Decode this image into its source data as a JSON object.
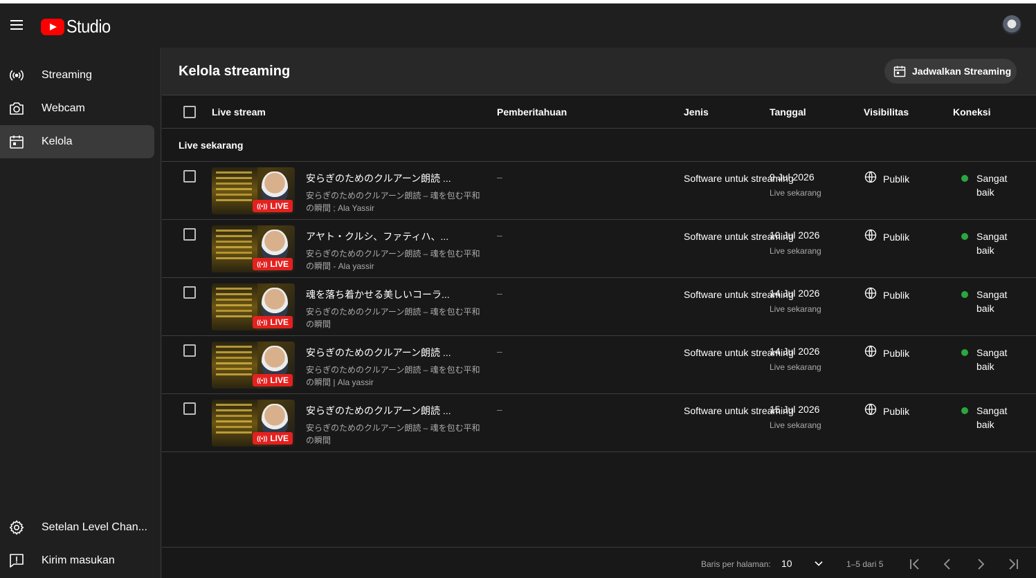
{
  "header": {
    "logo_text": "Studio",
    "menu_icon": "hamburger-menu-icon",
    "avatar_icon": "channel-avatar"
  },
  "sidebar": {
    "items": [
      {
        "label": "Streaming",
        "icon": "broadcast-icon"
      },
      {
        "label": "Webcam",
        "icon": "camera-icon"
      },
      {
        "label": "Kelola",
        "icon": "calendar-icon",
        "active": true
      }
    ],
    "bottom_items": [
      {
        "label": "Setelan Level Chan...",
        "icon": "gear-icon"
      },
      {
        "label": "Kirim masukan",
        "icon": "feedback-icon"
      }
    ]
  },
  "main": {
    "title": "Kelola streaming",
    "schedule_button": "Jadwalkan Streaming",
    "columns": [
      "Live stream",
      "Pemberitahuan",
      "Jenis",
      "Tanggal",
      "Visibilitas",
      "Koneksi"
    ],
    "section_label": "Live sekarang",
    "rows": [
      {
        "title": "安らぎのためのクルアーン朗読 ...",
        "desc": "安らぎのためのクルアーン朗読 – 魂を包む平和の瞬間 ; Ala Yassir",
        "notif": "–",
        "type": "Software untuk streaming",
        "date": "9 Jul 2026",
        "date_sub": "Live sekarang",
        "visibility": "Publik",
        "connection": "Sangat baik",
        "badge": "LIVE"
      },
      {
        "title": "アヤト・クルシ、ファティハ、...",
        "desc": "安らぎのためのクルアーン朗読 – 魂を包む平和の瞬間 - Ala yassir",
        "notif": "–",
        "type": "Software untuk streaming",
        "date": "10 Jul 2026",
        "date_sub": "Live sekarang",
        "visibility": "Publik",
        "connection": "Sangat baik",
        "badge": "LIVE"
      },
      {
        "title": "魂を落ち着かせる美しいコーラ...",
        "desc": "安らぎのためのクルアーン朗読 – 魂を包む平和の瞬間",
        "notif": "–",
        "type": "Software untuk streaming",
        "date": "14 Jul 2026",
        "date_sub": "Live sekarang",
        "visibility": "Publik",
        "connection": "Sangat baik",
        "badge": "LIVE"
      },
      {
        "title": "安らぎのためのクルアーン朗読 ...",
        "desc": "安らぎのためのクルアーン朗読 – 魂を包む平和の瞬間 | Ala yassir",
        "notif": "–",
        "type": "Software untuk streaming",
        "date": "14 Jul 2026",
        "date_sub": "Live sekarang",
        "visibility": "Publik",
        "connection": "Sangat baik",
        "badge": "LIVE"
      },
      {
        "title": "安らぎのためのクルアーン朗読 ...",
        "desc": "安らぎのためのクルアーン朗読 – 魂を包む平和の瞬間",
        "notif": "–",
        "type": "Software untuk streaming",
        "date": "15 Jul 2026",
        "date_sub": "Live sekarang",
        "visibility": "Publik",
        "connection": "Sangat baik",
        "badge": "LIVE"
      }
    ]
  },
  "footer": {
    "rows_label": "Baris per halaman:",
    "rows_value": "10",
    "range": "1–5 dari 5"
  },
  "colors": {
    "brand_red": "#ff0000",
    "live_red": "#e3211f",
    "connection_green": "#2ba640",
    "background": "#1f1f1f",
    "main_background": "#181818"
  }
}
